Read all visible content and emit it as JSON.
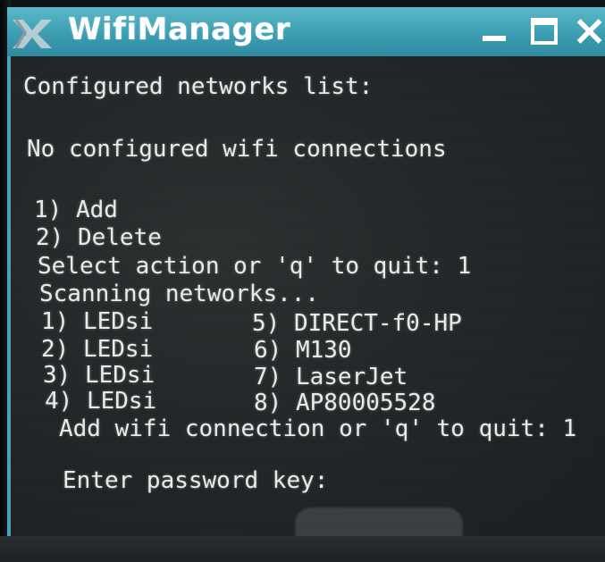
{
  "window": {
    "title": "WifiManager",
    "icons": {
      "app": "wifi-manager-app-icon",
      "minimize": "minimize-icon",
      "maximize": "maximize-icon",
      "close": "close-icon"
    },
    "colors": {
      "titlebar": "#3d9db2",
      "terminal_bg": "#232628",
      "text": "#e8ece8"
    }
  },
  "terminal": {
    "header": "Configured networks list:",
    "status": "No configured wifi connections",
    "menu": {
      "add": "1) Add",
      "delete": "2) Delete"
    },
    "select_prompt": "Select action or 'q' to quit: 1",
    "scanning": "Scanning networks...",
    "networks": [
      "1) LEDsi",
      "2) LEDsi",
      "3) LEDsi",
      "4) LEDsi",
      "5) DIRECT-f0-HP",
      "6) M130",
      "7) LaserJet",
      "8) AP80005528"
    ],
    "add_prompt": "Add wifi connection or 'q' to quit: 1",
    "password_prompt": "Enter password key:"
  }
}
